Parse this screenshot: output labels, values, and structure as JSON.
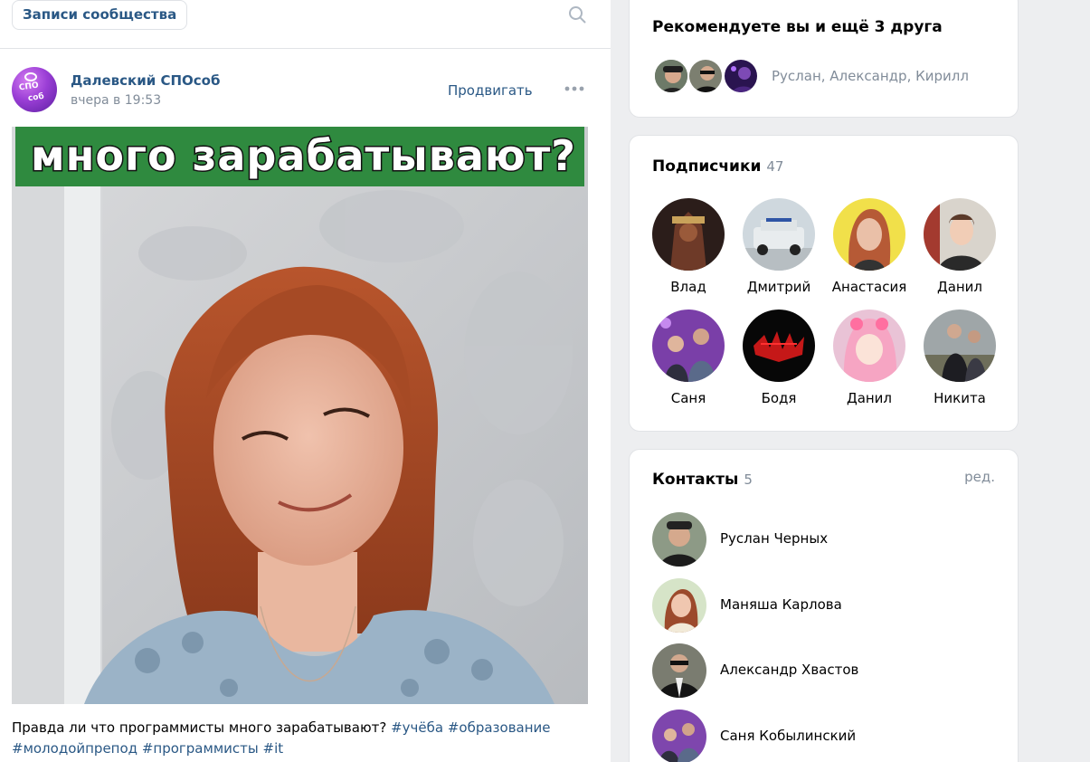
{
  "community_tab": {
    "label": "Записи сообщества"
  },
  "post": {
    "author": "Далевский СПОсоб",
    "time": "вчера в 19:53",
    "promote": "Продвигать",
    "image_caption_overlay": "много зарабатывают?",
    "text": "Правда ли что программисты много зарабатывают?",
    "tags_line1": [
      "#учёба",
      "#образование"
    ],
    "tags_line2": [
      "#молодойпрепод",
      "#программисты",
      "#it"
    ],
    "logo_line1": "СПО",
    "logo_line2": "соб"
  },
  "recommend": {
    "title": "Рекомендуете вы и ещё 3 друга",
    "names": "Руслан, Александр, Кирилл"
  },
  "subscribers": {
    "title": "Подписчики",
    "count": "47",
    "items": [
      {
        "name": "Влад"
      },
      {
        "name": "Дмитрий"
      },
      {
        "name": "Анастасия"
      },
      {
        "name": "Данил"
      },
      {
        "name": "Саня"
      },
      {
        "name": "Бодя"
      },
      {
        "name": "Данил"
      },
      {
        "name": "Никита"
      }
    ]
  },
  "contacts": {
    "title": "Контакты",
    "count": "5",
    "edit": "ред.",
    "items": [
      {
        "name": "Руслан Черных"
      },
      {
        "name": "Маняша Карлова"
      },
      {
        "name": "Александр Хвастов"
      },
      {
        "name": "Саня Кобылинский"
      }
    ]
  }
}
